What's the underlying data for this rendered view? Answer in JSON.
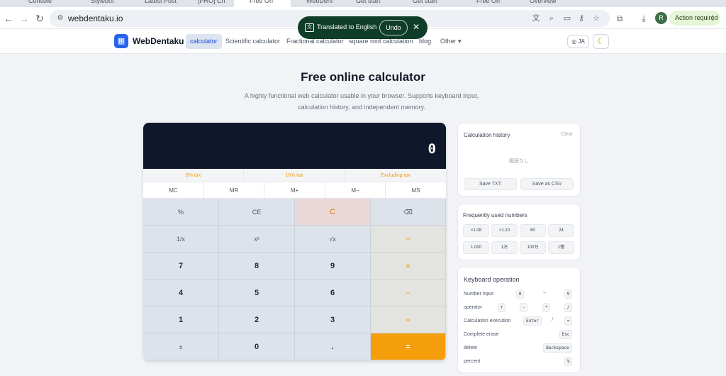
{
  "browser": {
    "tabs": [
      "Console",
      "Stylebot",
      "Latest Post",
      "[PRO] Ch",
      "Free On",
      "WebDent",
      "Get start",
      "Get start",
      "Free On",
      "Overview"
    ],
    "url": "webdentaku.io",
    "action_required": "Action required",
    "avatar": "R"
  },
  "translate": {
    "message": "Translated to English",
    "undo": "Undo",
    "close": "✕"
  },
  "site": {
    "logo": "WebDentaku",
    "nav": [
      "calculator",
      "Scientific calculator",
      "Fractional calculator",
      "square root calculation",
      "blog",
      "Other"
    ],
    "lang": "JA",
    "theme_icon": "☾"
  },
  "hero": {
    "title": "Free online calculator",
    "subtitle": "A highly functional web calculator usable in your browser. Supports keyboard input, calculation history, and independent memory."
  },
  "calculator": {
    "display": "0",
    "tax": [
      "8% tax",
      "10% tax",
      "Excluding tax"
    ],
    "memory": [
      "MC",
      "MR",
      "M+",
      "M−",
      "MS"
    ],
    "keys": [
      [
        "%",
        "CE",
        "C",
        "⌫"
      ],
      [
        "1/x",
        "x²",
        "√x",
        "÷"
      ],
      [
        "7",
        "8",
        "9",
        "×"
      ],
      [
        "4",
        "5",
        "6",
        "−"
      ],
      [
        "1",
        "2",
        "3",
        "+"
      ],
      [
        "±",
        "0",
        ".",
        "="
      ]
    ]
  },
  "history": {
    "title": "Calculation history",
    "clear": "Clear",
    "empty": "履歴なし",
    "save_txt": "Save TXT",
    "save_csv": "Save as CSV"
  },
  "frequent": {
    "title": "Frequently used numbers",
    "items": [
      "×1.08",
      "×1.10",
      "60",
      "24",
      "1,000",
      "1万",
      "100万",
      "1億"
    ]
  },
  "keyboard": {
    "title": "Keyboard operation",
    "rows": [
      {
        "label": "Number input",
        "keys": [
          "0",
          "9"
        ],
        "sep": "~"
      },
      {
        "label": "operator",
        "keys": [
          "+",
          "-",
          "*",
          "/"
        ],
        "sep": ""
      },
      {
        "label": "Calculation execution",
        "keys": [
          "Enter",
          "="
        ],
        "sep": "/"
      },
      {
        "label": "Complete erase",
        "keys": [
          "Esc"
        ],
        "sep": ""
      },
      {
        "label": "delete",
        "keys": [
          "Backspace"
        ],
        "sep": ""
      },
      {
        "label": "percent",
        "keys": [
          "%"
        ],
        "sep": ""
      }
    ]
  }
}
